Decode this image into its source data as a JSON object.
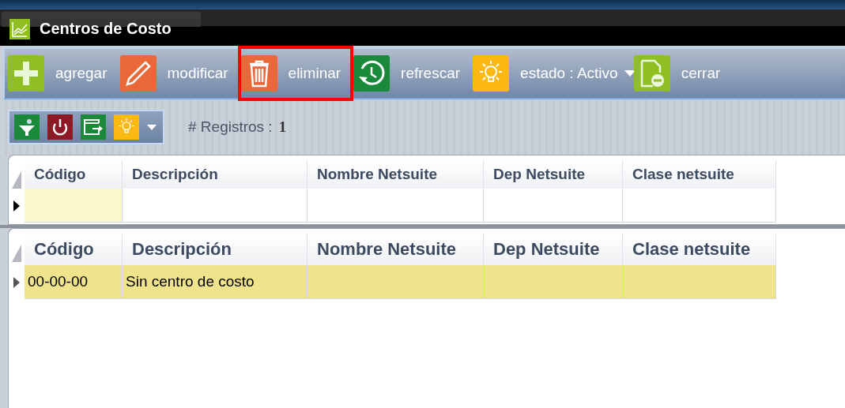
{
  "tab": {
    "title": "Centros de Costo",
    "selected": true
  },
  "toolbar": [
    {
      "kind": "button",
      "label": "agregar",
      "highlighted": false
    },
    {
      "kind": "button",
      "label": "modificar",
      "highlighted": false
    },
    {
      "kind": "button",
      "label": "eliminar",
      "highlighted": true
    },
    {
      "kind": "button",
      "label": "refrescar",
      "highlighted": false
    },
    {
      "kind": "dropdown",
      "label": "estado : Activo",
      "highlighted": false
    },
    {
      "kind": "button",
      "label": "cerrar",
      "highlighted": false
    }
  ],
  "records": {
    "label": "# Registros :",
    "value": "1"
  },
  "filter_grid": {
    "columns": [
      "Código",
      "Descripción",
      "Nombre Netsuite",
      "Dep Netsuite",
      "Clase netsuite"
    ],
    "cells": [
      {
        "focused": true
      },
      {
        "focused": false
      },
      {
        "focused": false
      },
      {
        "focused": false
      },
      {
        "focused": false
      }
    ]
  },
  "grid": {
    "columns": [
      "Código",
      "Descripción",
      "Nombre Netsuite",
      "Dep Netsuite",
      "Clase netsuite"
    ],
    "rows": [
      {
        "selected": true,
        "cells": [
          "00-00-00",
          "Sin centro de costo"
        ]
      }
    ]
  }
}
